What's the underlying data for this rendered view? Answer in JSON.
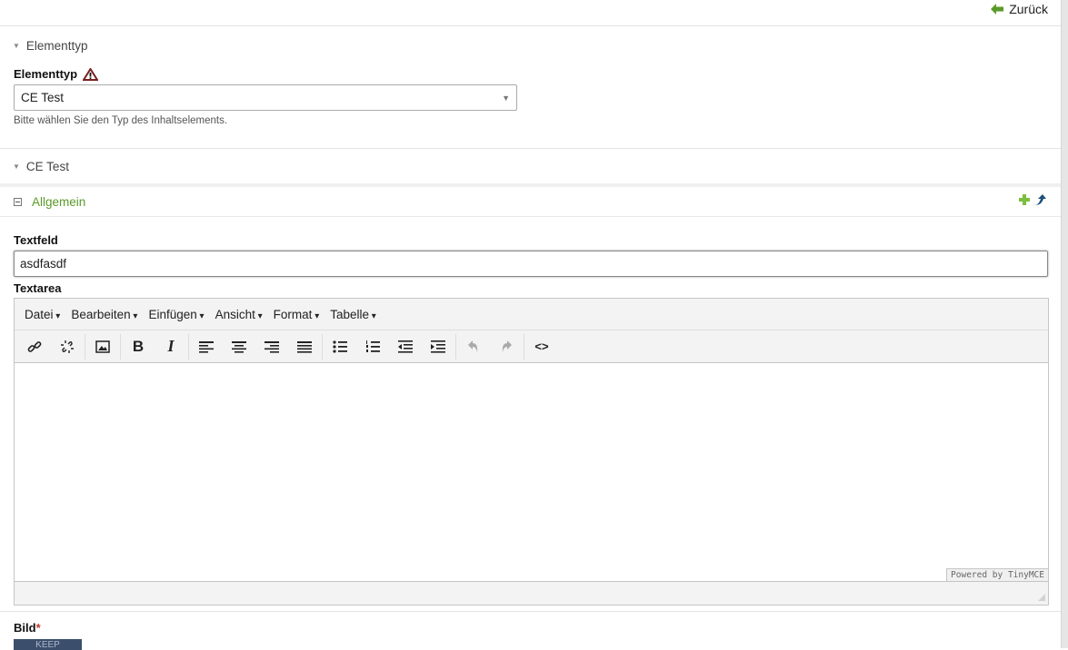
{
  "topbar": {
    "back_label": "Zurück",
    "back_icon": "arrow-left-icon",
    "accent": "#5a9a2a"
  },
  "section_elementtyp": {
    "title": "Elementtyp",
    "field_label": "Elementtyp",
    "warning_icon": "warning-icon",
    "select_value": "CE Test",
    "help": "Bitte wählen Sie den Typ des Inhaltselements."
  },
  "section_ce": {
    "title": "CE Test"
  },
  "group": {
    "title": "Allgemein",
    "add_icon": "plus-icon",
    "move_icon": "arrow-up-curved-icon"
  },
  "textfeld": {
    "label": "Textfeld",
    "value": "asdfasdf"
  },
  "textarea": {
    "label": "Textarea",
    "menus": [
      "Datei",
      "Bearbeiten",
      "Einfügen",
      "Ansicht",
      "Format",
      "Tabelle"
    ],
    "powered": "Powered by TinyMCE"
  },
  "bild": {
    "label": "Bild",
    "required_mark": "*",
    "image_text": "KEEP"
  }
}
